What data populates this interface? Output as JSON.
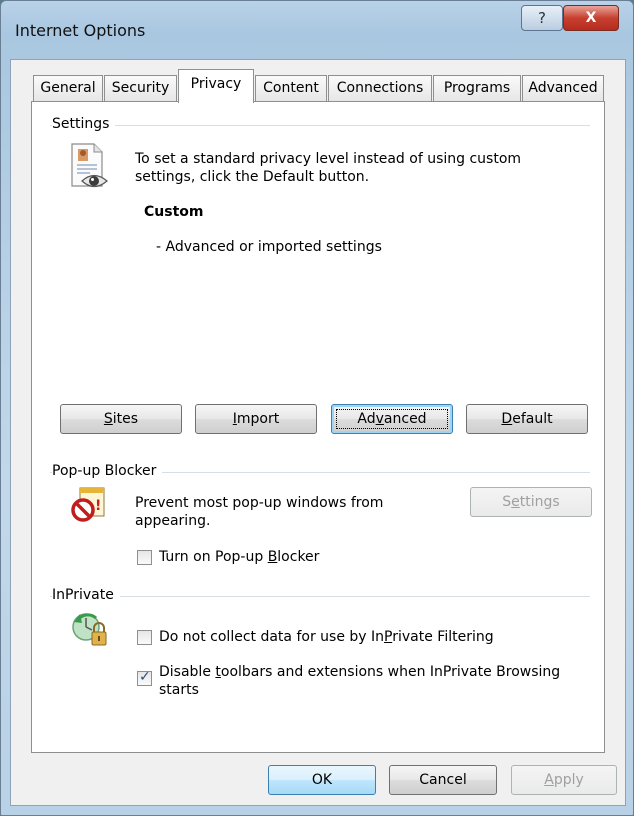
{
  "window": {
    "title": "Internet Options",
    "help_glyph": "?",
    "close_glyph": "X"
  },
  "tabs": [
    {
      "label": "General"
    },
    {
      "label": "Security"
    },
    {
      "label": "Privacy",
      "active": true
    },
    {
      "label": "Content"
    },
    {
      "label": "Connections"
    },
    {
      "label": "Programs"
    },
    {
      "label": "Advanced"
    }
  ],
  "settings": {
    "group_label": "Settings",
    "icon": "privacy-document-eye-icon",
    "description_line1": "To set a standard privacy level instead of using custom",
    "description_line2": "settings, click the Default button.",
    "level_name": "Custom",
    "level_detail": "- Advanced or imported settings",
    "buttons": {
      "sites": {
        "pre": "",
        "accel": "S",
        "post": "ites"
      },
      "import": {
        "pre": "",
        "accel": "I",
        "post": "mport"
      },
      "advanced": {
        "pre": "Ad",
        "accel": "v",
        "post": "anced"
      },
      "default": {
        "pre": "",
        "accel": "D",
        "post": "efault"
      }
    }
  },
  "popup_blocker": {
    "group_label": "Pop-up Blocker",
    "icon": "popup-blocker-icon",
    "description_line1": "Prevent most pop-up windows from",
    "description_line2": "appearing.",
    "settings_button": {
      "pre": "S",
      "accel": "e",
      "post": "ttings",
      "disabled": true
    },
    "checkbox": {
      "pre": "Turn on Pop-up ",
      "accel": "B",
      "post": "locker",
      "checked": false
    }
  },
  "inprivate": {
    "group_label": "InPrivate",
    "icon": "inprivate-lock-icon",
    "filtering_checkbox": {
      "pre": "Do not collect data for use by In",
      "accel": "P",
      "post": "rivate Filtering",
      "checked": false
    },
    "toolbars_checkbox": {
      "pre": "Disable ",
      "accel": "t",
      "post": "oolbars and extensions when InPrivate Browsing",
      "line2": "starts",
      "checked": true
    }
  },
  "footer": {
    "ok_label": "OK",
    "cancel_label": "Cancel",
    "apply": {
      "pre": "",
      "accel": "A",
      "post": "pply",
      "disabled": true
    }
  },
  "colors": {
    "titlebar": "#b8d2e8",
    "close_button": "#c7402f",
    "panel_background": "#ffffff",
    "dialog_background": "#f0f0f0",
    "group_line": "#d5dfe5"
  }
}
